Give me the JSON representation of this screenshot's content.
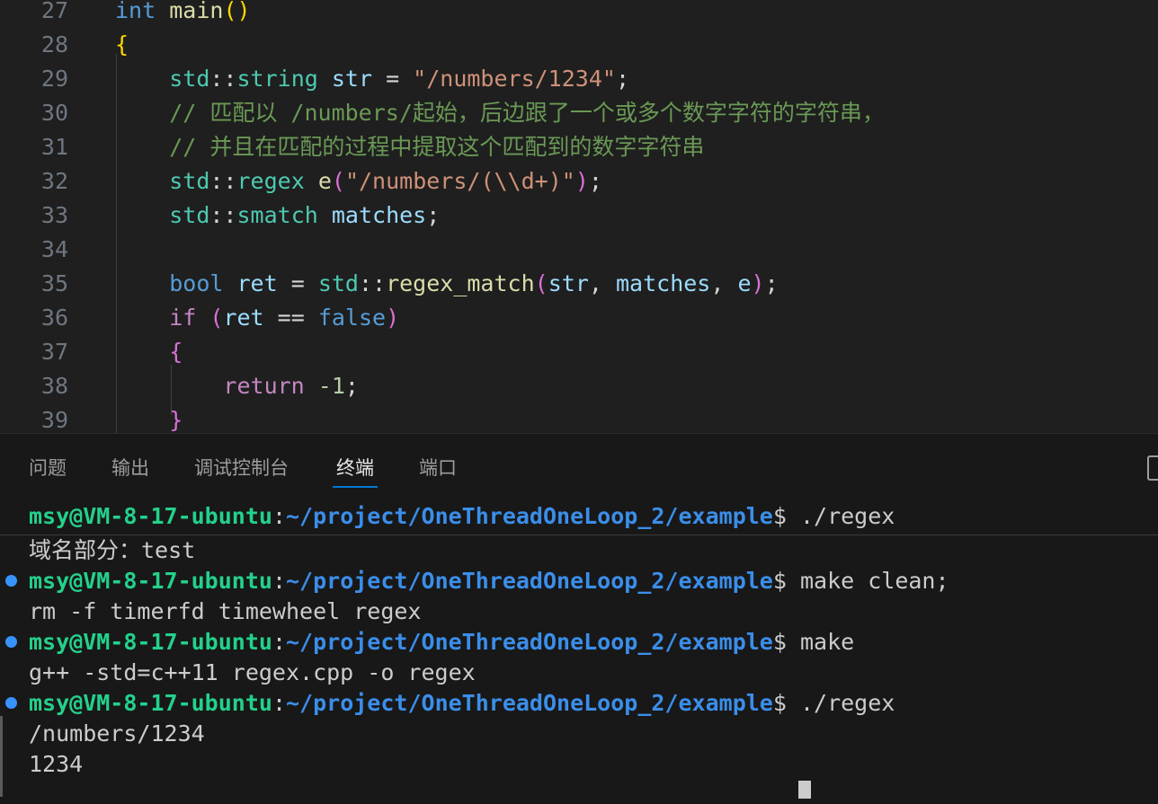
{
  "editor": {
    "lines": [
      {
        "num": "27",
        "tokens": [
          [
            "int",
            "kw"
          ],
          [
            " ",
            ""
          ],
          [
            "main",
            "fn"
          ],
          [
            "()",
            "p1"
          ]
        ]
      },
      {
        "num": "28",
        "tokens": [
          [
            "{",
            "p1"
          ]
        ]
      },
      {
        "num": "29",
        "tokens": [
          [
            "    ",
            ""
          ],
          [
            "std",
            "ty"
          ],
          [
            "::",
            "op"
          ],
          [
            "string",
            "ty"
          ],
          [
            " ",
            ""
          ],
          [
            "str",
            "var"
          ],
          [
            " = ",
            "op"
          ],
          [
            "\"/numbers/1234\"",
            "str"
          ],
          [
            ";",
            "op"
          ]
        ]
      },
      {
        "num": "30",
        "tokens": [
          [
            "    ",
            ""
          ],
          [
            "// 匹配以 /numbers/起始，后边跟了一个或多个数字字符的字符串，",
            "com"
          ]
        ]
      },
      {
        "num": "31",
        "tokens": [
          [
            "    ",
            ""
          ],
          [
            "// 并且在匹配的过程中提取这个匹配到的数字字符串",
            "com"
          ]
        ]
      },
      {
        "num": "32",
        "tokens": [
          [
            "    ",
            ""
          ],
          [
            "std",
            "ty"
          ],
          [
            "::",
            "op"
          ],
          [
            "regex",
            "ty"
          ],
          [
            " ",
            ""
          ],
          [
            "e",
            "fn"
          ],
          [
            "(",
            "p2"
          ],
          [
            "\"/numbers/(\\\\d+)\"",
            "str"
          ],
          [
            ")",
            "p2"
          ],
          [
            ";",
            "op"
          ]
        ]
      },
      {
        "num": "33",
        "tokens": [
          [
            "    ",
            ""
          ],
          [
            "std",
            "ty"
          ],
          [
            "::",
            "op"
          ],
          [
            "smatch",
            "ty"
          ],
          [
            " ",
            ""
          ],
          [
            "matches",
            "var"
          ],
          [
            ";",
            "op"
          ]
        ]
      },
      {
        "num": "34",
        "tokens": []
      },
      {
        "num": "35",
        "tokens": [
          [
            "    ",
            ""
          ],
          [
            "bool",
            "kw"
          ],
          [
            " ",
            ""
          ],
          [
            "ret",
            "var"
          ],
          [
            " = ",
            "op"
          ],
          [
            "std",
            "ty"
          ],
          [
            "::",
            "op"
          ],
          [
            "regex_match",
            "fn"
          ],
          [
            "(",
            "p2"
          ],
          [
            "str",
            "var"
          ],
          [
            ", ",
            "op"
          ],
          [
            "matches",
            "var"
          ],
          [
            ", ",
            "op"
          ],
          [
            "e",
            "var"
          ],
          [
            ")",
            "p2"
          ],
          [
            ";",
            "op"
          ]
        ]
      },
      {
        "num": "36",
        "tokens": [
          [
            "    ",
            ""
          ],
          [
            "if",
            "ctl"
          ],
          [
            " ",
            ""
          ],
          [
            "(",
            "p2"
          ],
          [
            "ret",
            "var"
          ],
          [
            " == ",
            "op"
          ],
          [
            "false",
            "kw"
          ],
          [
            ")",
            "p2"
          ]
        ]
      },
      {
        "num": "37",
        "tokens": [
          [
            "    ",
            ""
          ],
          [
            "{",
            "p2"
          ]
        ]
      },
      {
        "num": "38",
        "tokens": [
          [
            "        ",
            ""
          ],
          [
            "return",
            "ctl"
          ],
          [
            " ",
            ""
          ],
          [
            "-1",
            "num"
          ],
          [
            ";",
            "op"
          ]
        ]
      },
      {
        "num": "39",
        "tokens": [
          [
            "    ",
            ""
          ],
          [
            "}",
            "p2"
          ]
        ]
      }
    ]
  },
  "panel": {
    "tabs": [
      {
        "label": "问题",
        "active": false
      },
      {
        "label": "输出",
        "active": false
      },
      {
        "label": "调试控制台",
        "active": false
      },
      {
        "label": "终端",
        "active": true
      },
      {
        "label": "端口",
        "active": false
      }
    ]
  },
  "terminal": {
    "lines": [
      {
        "type": "prompt",
        "user": "msy@VM-8-17-ubuntu",
        "path": "~/project/OneThreadOneLoop_2/example",
        "cmd": " ./regex",
        "dot": false
      },
      {
        "type": "out",
        "text": "域名部分：test"
      },
      {
        "type": "prompt",
        "user": "msy@VM-8-17-ubuntu",
        "path": "~/project/OneThreadOneLoop_2/example",
        "cmd": " make clean;",
        "dot": true
      },
      {
        "type": "out",
        "text": "rm -f timerfd timewheel regex"
      },
      {
        "type": "prompt",
        "user": "msy@VM-8-17-ubuntu",
        "path": "~/project/OneThreadOneLoop_2/example",
        "cmd": " make",
        "dot": true
      },
      {
        "type": "out",
        "text": "g++ -std=c++11 regex.cpp -o regex"
      },
      {
        "type": "prompt",
        "user": "msy@VM-8-17-ubuntu",
        "path": "~/project/OneThreadOneLoop_2/example",
        "cmd": " ./regex",
        "dot": true
      },
      {
        "type": "out",
        "text": "/numbers/1234"
      },
      {
        "type": "out",
        "text": "1234"
      }
    ]
  },
  "colors": {
    "accent": "#0078d4",
    "prompt_user": "#23d18b",
    "prompt_path": "#3b8eea",
    "dot": "#3794ff"
  }
}
